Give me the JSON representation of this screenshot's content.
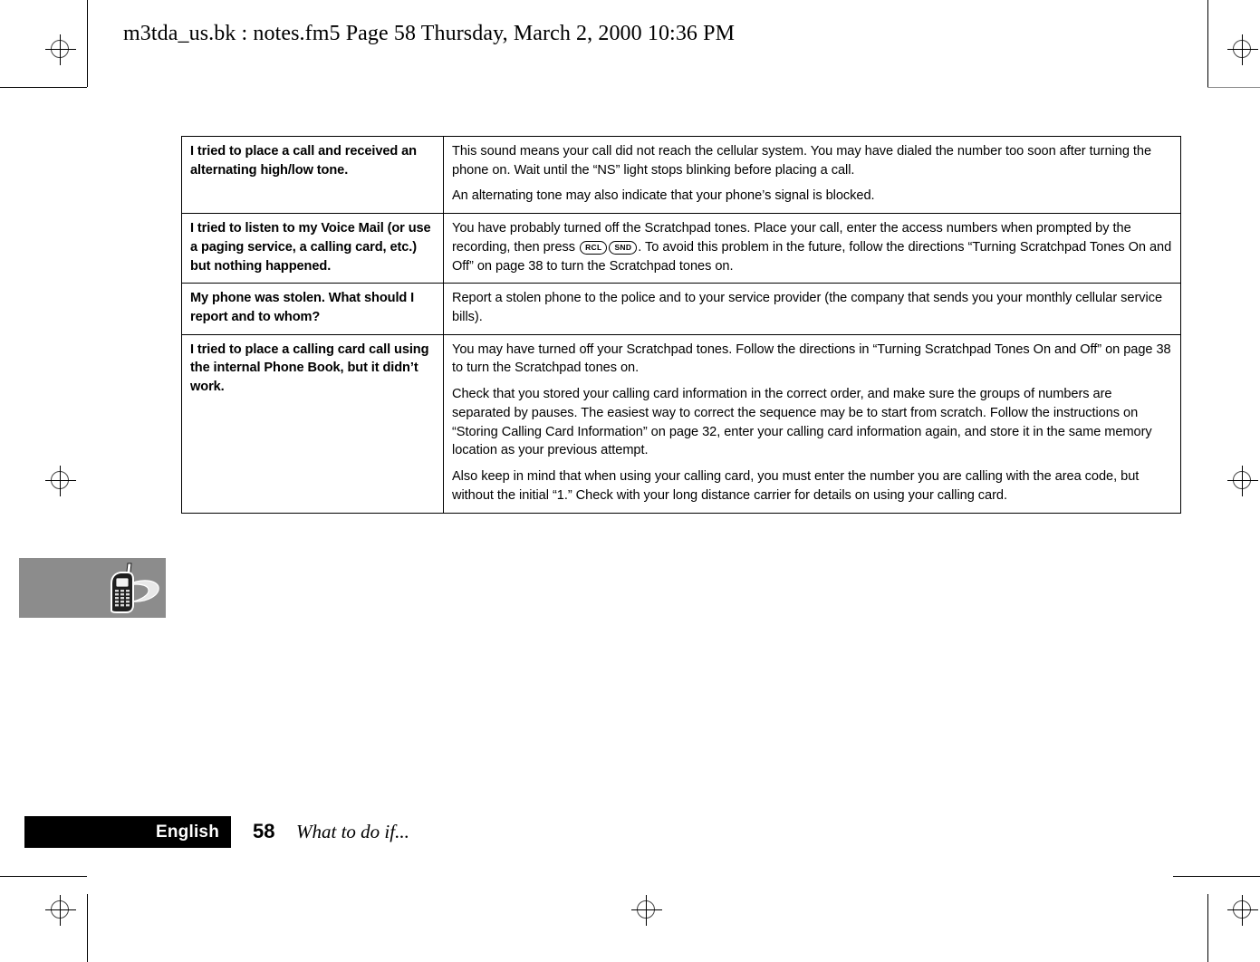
{
  "header": {
    "text": "m3tda_us.bk : notes.fm5  Page 58  Thursday, March 2, 2000  10:36 PM"
  },
  "table": {
    "rows": [
      {
        "question": "I tried to place a call and received an alternating high/low tone.",
        "answers": [
          "This sound means your call did not reach the cellular system. You may have dialed the number too soon after turning the phone on. Wait until the “NS” light stops blinking before placing a call.",
          "An alternating tone may also indicate that your phone’s signal is blocked."
        ]
      },
      {
        "question": "I tried to listen to my Voice Mail (or use a paging service, a calling card, etc.) but nothing happened.",
        "answer_part1": "You have probably turned off the Scratchpad tones. Place your call, enter the access numbers when prompted by the recording, then press ",
        "key1": "RCL",
        "key2": "SND",
        "answer_part2": ". To avoid this problem in the future, follow the directions “Turning Scratchpad Tones On and Off” on page 38 to turn the Scratchpad tones on."
      },
      {
        "question": "My phone was stolen. What should I report and to whom?",
        "answers": [
          "Report a stolen phone to the police and to your service provider (the company that sends you your monthly cellular service bills)."
        ]
      },
      {
        "question": "I tried to place a calling card call using the internal Phone Book, but it didn’t work.",
        "answers": [
          "You may have turned off your Scratchpad tones. Follow the directions in “Turning Scratchpad Tones On and Off” on page 38 to turn the Scratchpad tones on.",
          "Check that you stored your calling card information in the correct order, and make sure the groups of numbers are separated by pauses. The easiest way to correct the sequence may be to start from scratch. Follow the instructions on “Storing Calling Card Information” on page 32, enter your calling card information again, and store it in the same memory location as your previous attempt.",
          "Also keep in mind that when using your calling card, you must enter the number you are calling with the area code, but without the initial “1.” Check with your long distance carrier for details on using your calling card."
        ]
      }
    ]
  },
  "sidebar_graphic": {
    "icon": "cell-phone-icon",
    "background_color": "#8c8c8c"
  },
  "footer": {
    "language": "English",
    "page_number": "58",
    "section_title": "What to do if...",
    "bar_color": "#000000"
  }
}
